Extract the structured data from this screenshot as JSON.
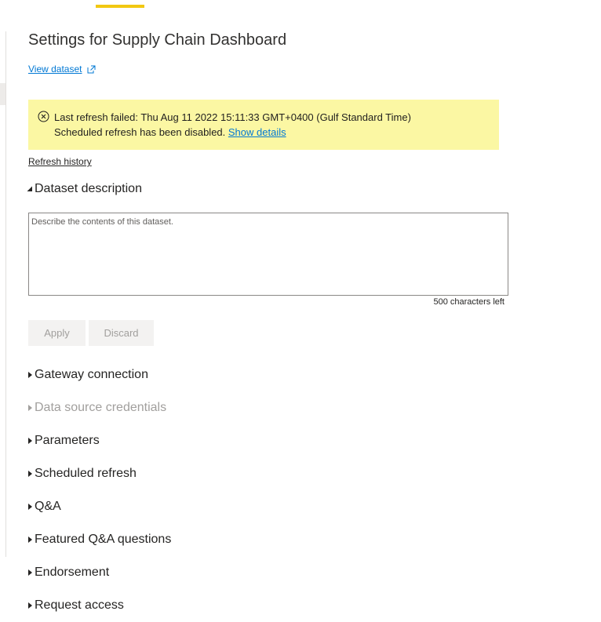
{
  "header": {
    "title": "Settings for Supply Chain Dashboard",
    "view_dataset_label": "View dataset"
  },
  "alert": {
    "line1": "Last refresh failed: Thu Aug 11 2022 15:11:33 GMT+0400 (Gulf Standard Time)",
    "line2": "Scheduled refresh has been disabled.",
    "show_details_label": "Show details",
    "icon": "error-circle-icon"
  },
  "refresh_history_label": "Refresh history",
  "description": {
    "heading": "Dataset description",
    "placeholder": "Describe the contents of this dataset.",
    "value": "",
    "chars_left": "500 characters left",
    "apply_label": "Apply",
    "discard_label": "Discard"
  },
  "sections": [
    {
      "label": "Gateway connection",
      "disabled": false
    },
    {
      "label": "Data source credentials",
      "disabled": true
    },
    {
      "label": "Parameters",
      "disabled": false
    },
    {
      "label": "Scheduled refresh",
      "disabled": false
    },
    {
      "label": "Q&A",
      "disabled": false
    },
    {
      "label": "Featured Q&A questions",
      "disabled": false
    },
    {
      "label": "Endorsement",
      "disabled": false
    },
    {
      "label": "Request access",
      "disabled": false
    }
  ],
  "colors": {
    "accent": "#f2c811",
    "link": "#0078d4",
    "alert_background": "#fbf7a3",
    "disabled_text": "#a19f9d"
  }
}
